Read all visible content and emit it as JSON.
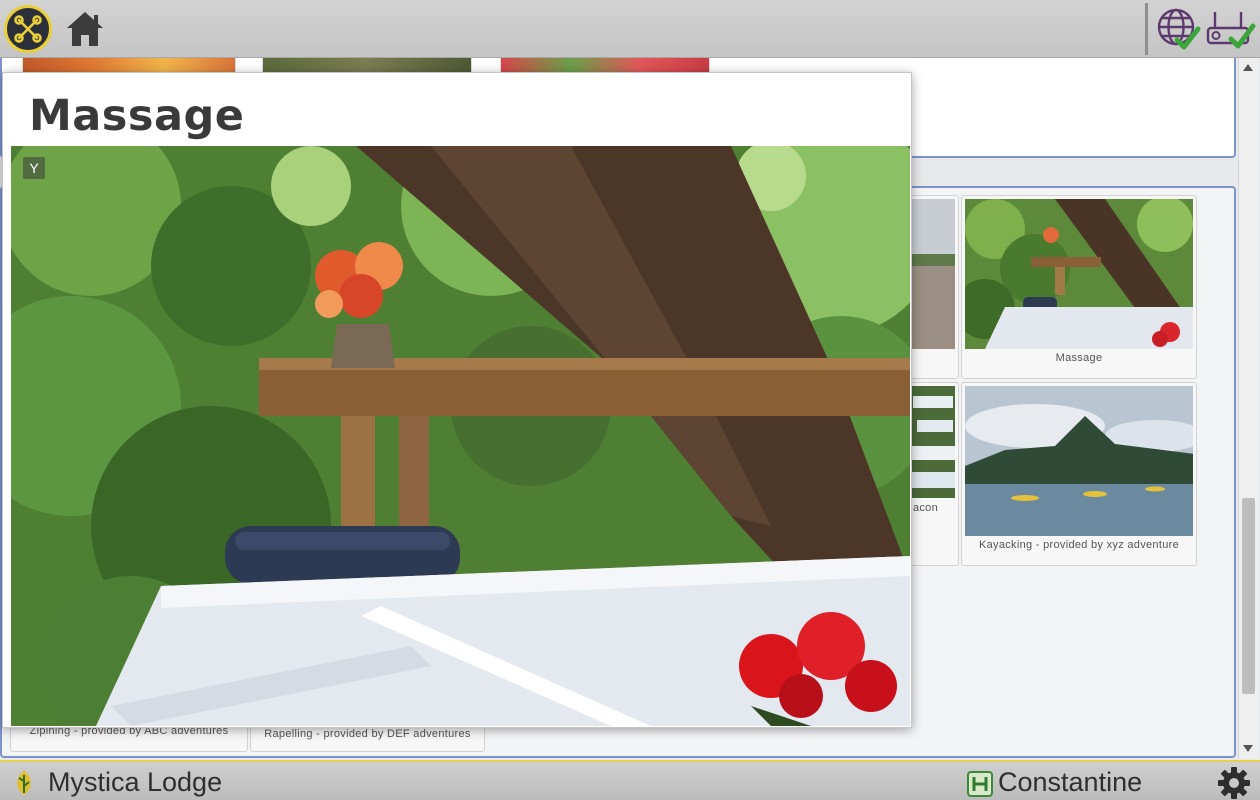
{
  "header": {
    "logo_icon": "app-logo-icon",
    "home_icon": "home-icon",
    "status_icons": [
      "globe-check-icon",
      "router-check-icon"
    ],
    "accent_color": "#e8cf3a",
    "status_ok_color": "#3aa63a"
  },
  "activities": {
    "cards": [
      {
        "label": "Massage"
      },
      {
        "label": "Kayacking - provided by xyz adventure"
      },
      {
        "label": "acon"
      },
      {
        "label": "Zipining - provided by ABC adventures"
      },
      {
        "label": "Rapelling - provided by DEF adventures"
      }
    ]
  },
  "modal": {
    "title": "Massage",
    "close_glyph": "Y"
  },
  "footer": {
    "lodge_name": "Mystica Lodge",
    "user_name": "Constantine",
    "settings_icon": "gear-icon"
  }
}
